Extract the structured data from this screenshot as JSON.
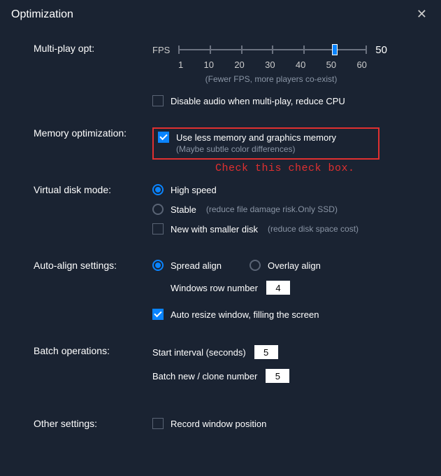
{
  "window": {
    "title": "Optimization",
    "close_glyph": "✕"
  },
  "multiplay": {
    "section_label": "Multi-play opt:",
    "fps_label": "FPS",
    "value": 50,
    "ticks": [
      "1",
      "10",
      "20",
      "30",
      "40",
      "50",
      "60"
    ],
    "hint": "(Fewer FPS, more players co-exist)",
    "disable_audio": {
      "checked": false,
      "label": "Disable audio when multi-play, reduce CPU"
    }
  },
  "memory": {
    "section_label": "Memory optimization:",
    "use_less": {
      "checked": true,
      "label": "Use less memory and graphics memory",
      "sub": "(Maybe subtle color differences)"
    },
    "annotation": "Check this check box."
  },
  "vdisk": {
    "section_label": "Virtual disk mode:",
    "high_speed": {
      "checked": true,
      "label": "High speed"
    },
    "stable": {
      "checked": false,
      "label": "Stable",
      "hint": "(reduce file damage risk.Only SSD)"
    },
    "smaller": {
      "checked": false,
      "label": "New with smaller disk",
      "hint": "(reduce disk space cost)"
    }
  },
  "align": {
    "section_label": "Auto-align settings:",
    "spread": {
      "checked": true,
      "label": "Spread align"
    },
    "overlay": {
      "checked": false,
      "label": "Overlay align"
    },
    "row_num": {
      "label": "Windows row number",
      "value": "4"
    },
    "auto_resize": {
      "checked": true,
      "label": "Auto resize window, filling the screen"
    }
  },
  "batch": {
    "section_label": "Batch operations:",
    "interval": {
      "label": "Start interval (seconds)",
      "value": "5"
    },
    "clone": {
      "label": "Batch new / clone number",
      "value": "5"
    }
  },
  "other": {
    "section_label": "Other settings:",
    "record": {
      "checked": false,
      "label": "Record window position"
    }
  }
}
